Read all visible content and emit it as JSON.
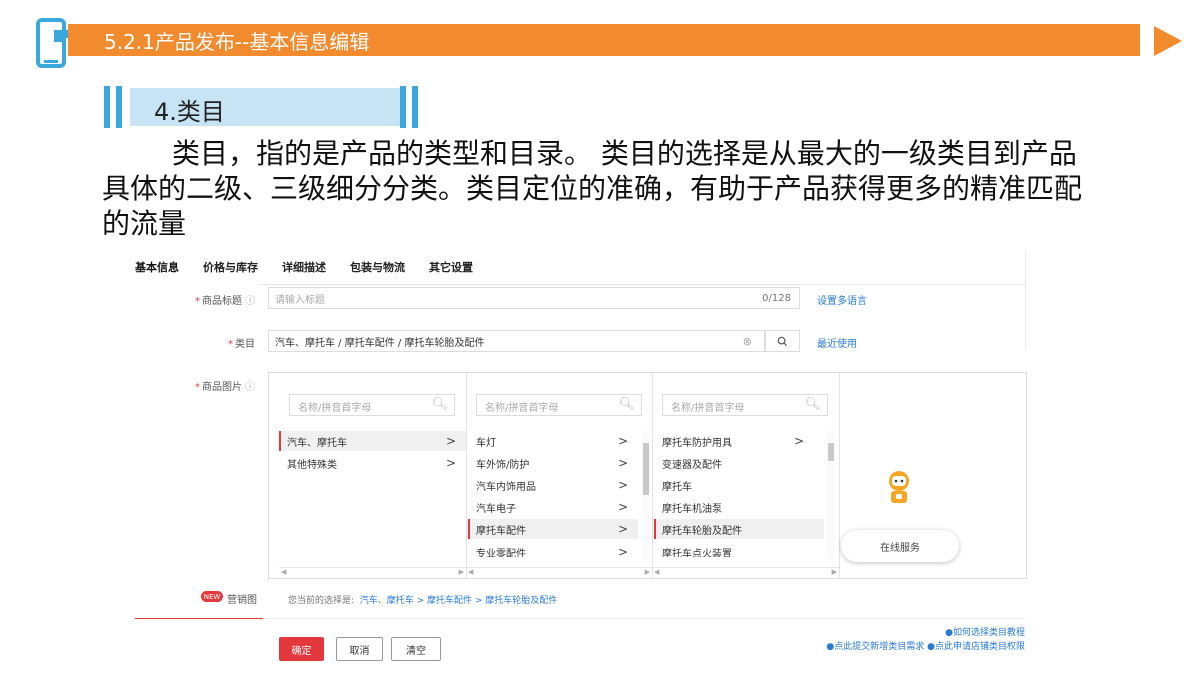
{
  "slide": {
    "header_title": "5.2.1产品发布--基本信息编辑",
    "section_title": "4.类目",
    "paragraph": "类目，指的是产品的类型和目录。 类目的选择是从最大的一级类目到产品具体的二级、三级细分分类。类目定位的准确，有助于产品获得更多的精准匹配的流量"
  },
  "tabs": [
    "基本信息",
    "价格与库存",
    "详细描述",
    "包装与物流",
    "其它设置"
  ],
  "form": {
    "title_label": "商品标题",
    "title_placeholder": "请输入标题",
    "title_count": "0/128",
    "title_link": "设置多语言",
    "category_label": "类目",
    "category_value": "汽车、摩托车 / 摩托车配件 / 摩托车轮胎及配件",
    "category_link": "最近使用",
    "image_label": "商品图片",
    "marketing_label": "营销图",
    "new_badge": "NEW"
  },
  "category_picker": {
    "search_placeholder": "名称/拼音首字母",
    "col1": [
      {
        "label": "汽车、摩托车",
        "arrow": ">"
      },
      {
        "label": "其他特殊类",
        "arrow": ">"
      }
    ],
    "col2": [
      {
        "label": "车灯",
        "arrow": ">"
      },
      {
        "label": "车外饰/防护",
        "arrow": ">"
      },
      {
        "label": "汽车内饰用品",
        "arrow": ">"
      },
      {
        "label": "汽车电子",
        "arrow": ">"
      },
      {
        "label": "摩托车配件",
        "arrow": ">"
      },
      {
        "label": "专业零配件",
        "arrow": ">"
      }
    ],
    "col3": [
      {
        "label": "摩托车防护用具",
        "arrow": ">"
      },
      {
        "label": "变速器及配件",
        "arrow": ""
      },
      {
        "label": "摩托车",
        "arrow": ""
      },
      {
        "label": "摩托车机油泵",
        "arrow": ""
      },
      {
        "label": "摩托车轮胎及配件",
        "arrow": ""
      },
      {
        "label": "摩托车点火装置",
        "arrow": ""
      }
    ],
    "online_service": "在线服务"
  },
  "current_selection": {
    "prefix": "您当前的选择是:",
    "path": "汽车、摩托车 > 摩托车配件 > 摩托车轮胎及配件"
  },
  "buttons": {
    "ok": "确定",
    "cancel": "取消",
    "clear": "清空"
  },
  "help_links": {
    "tutorial": "●如何选择类目教程",
    "request": "●点此提交新增类目需求 ●点此申请店铺类目权限"
  },
  "colors": {
    "header_orange": "#f28a2e",
    "section_blue": "#3aa8dc",
    "accent_red": "#e4393c",
    "link_blue": "#2b7bd6"
  }
}
